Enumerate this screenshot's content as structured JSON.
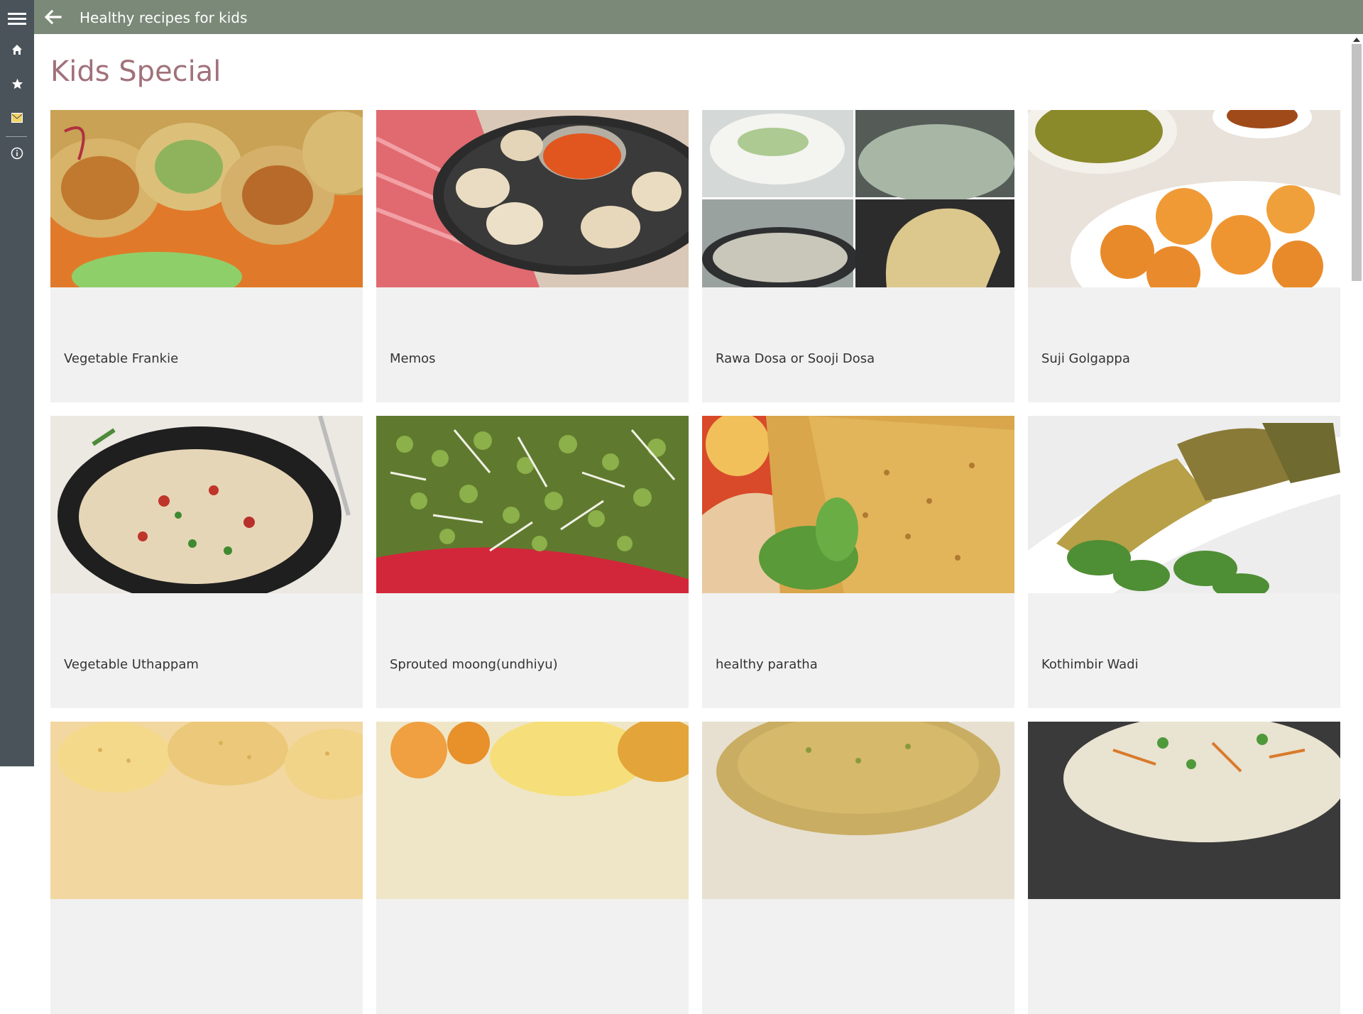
{
  "app": {
    "title": "Healthy recipes for kids"
  },
  "nav": {
    "items": [
      {
        "icon": "menu-icon"
      },
      {
        "icon": "home-icon"
      },
      {
        "icon": "star-icon"
      },
      {
        "icon": "mail-icon"
      },
      {
        "icon": "info-icon"
      }
    ]
  },
  "page": {
    "title": "Kids Special"
  },
  "recipes": [
    {
      "name": "Vegetable Frankie"
    },
    {
      "name": "Memos"
    },
    {
      "name": "Rawa Dosa or Sooji Dosa"
    },
    {
      "name": "Suji Golgappa"
    },
    {
      "name": "Vegetable Uthappam"
    },
    {
      "name": "Sprouted moong(undhiyu)"
    },
    {
      "name": "healthy paratha"
    },
    {
      "name": "Kothimbir Wadi"
    },
    {
      "name": ""
    },
    {
      "name": ""
    },
    {
      "name": ""
    },
    {
      "name": ""
    }
  ],
  "colors": {
    "topbar": "#7b8a78",
    "sidebar": "#4a535a",
    "title_accent": "#a1717a",
    "tile_bg": "#f1f1f1"
  }
}
